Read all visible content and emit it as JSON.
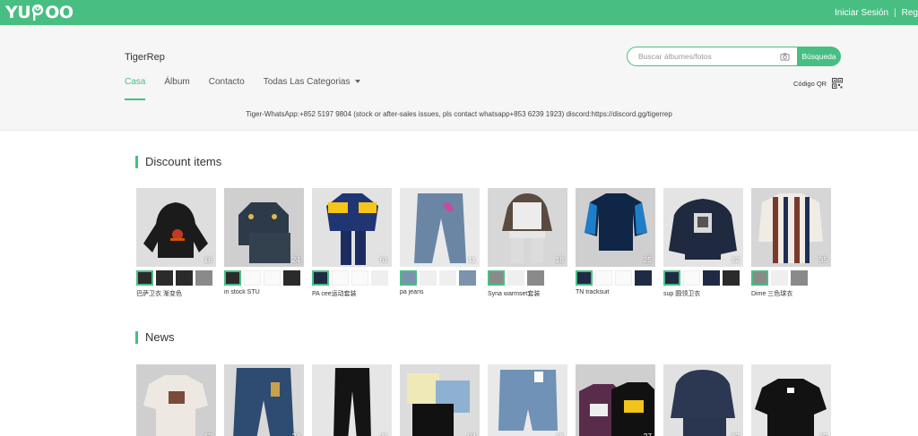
{
  "brand": {
    "logo_text_a": "YU",
    "logo_text_b": "OO",
    "accent": "#49be83"
  },
  "top_links": {
    "login": "Iniciar Sesión",
    "separator": "|",
    "register": "Reg"
  },
  "store": {
    "name": "TigerRep"
  },
  "search": {
    "placeholder": "Buscar álbumes/fotos",
    "button": "Búsqueda",
    "camera_icon": "camera-icon"
  },
  "nav": {
    "items": [
      "Casa",
      "Álbum",
      "Contacto",
      "Todas Las Categorias"
    ],
    "active": "Casa"
  },
  "qr": {
    "label": "Código QR",
    "icon": "qr-code-icon"
  },
  "contact_line": "Tiger-WhatsApp:+852 5197 9804 (stock or after-sales issues, pls contact whatsapp+853 6239 1923)  discord:https://discord.gg/tigerrep",
  "sections": [
    {
      "title": "Discount items",
      "items": [
        {
          "count": "16",
          "caption": "巴萨卫衣 渐变色",
          "thumbs": [
            "dark",
            "dark",
            "dark",
            "mid"
          ]
        },
        {
          "count": "24",
          "caption": "in stock STU",
          "thumbs": [
            "dark",
            "tag",
            "tag",
            "dark"
          ]
        },
        {
          "count": "61",
          "caption": "PA cee运动套装",
          "thumbs": [
            "navy",
            "tag",
            "tag",
            "light"
          ]
        },
        {
          "count": "11",
          "caption": "pa jeans",
          "thumbs": [
            "denim",
            "light",
            "light",
            "denim"
          ]
        },
        {
          "count": "18",
          "caption": "Syna warmset套装",
          "thumbs": [
            "mid",
            "light",
            "mid"
          ]
        },
        {
          "count": "25",
          "caption": "TN tracksuit",
          "thumbs": [
            "navy",
            "tag",
            "tag",
            "navy"
          ]
        },
        {
          "count": "12",
          "caption": "sup 圆领卫衣",
          "thumbs": [
            "navy",
            "tag",
            "navy",
            "dark"
          ]
        },
        {
          "count": "35",
          "caption": "Dime 三色球衣",
          "thumbs": [
            "mid",
            "light",
            "mid"
          ]
        }
      ]
    },
    {
      "title": "News",
      "items": [
        {
          "count": "12"
        },
        {
          "count": "24"
        },
        {
          "count": "21"
        },
        {
          "count": "04"
        },
        {
          "count": "16"
        },
        {
          "count": "27"
        },
        {
          "count": "32"
        },
        {
          "count": "19"
        }
      ]
    }
  ]
}
